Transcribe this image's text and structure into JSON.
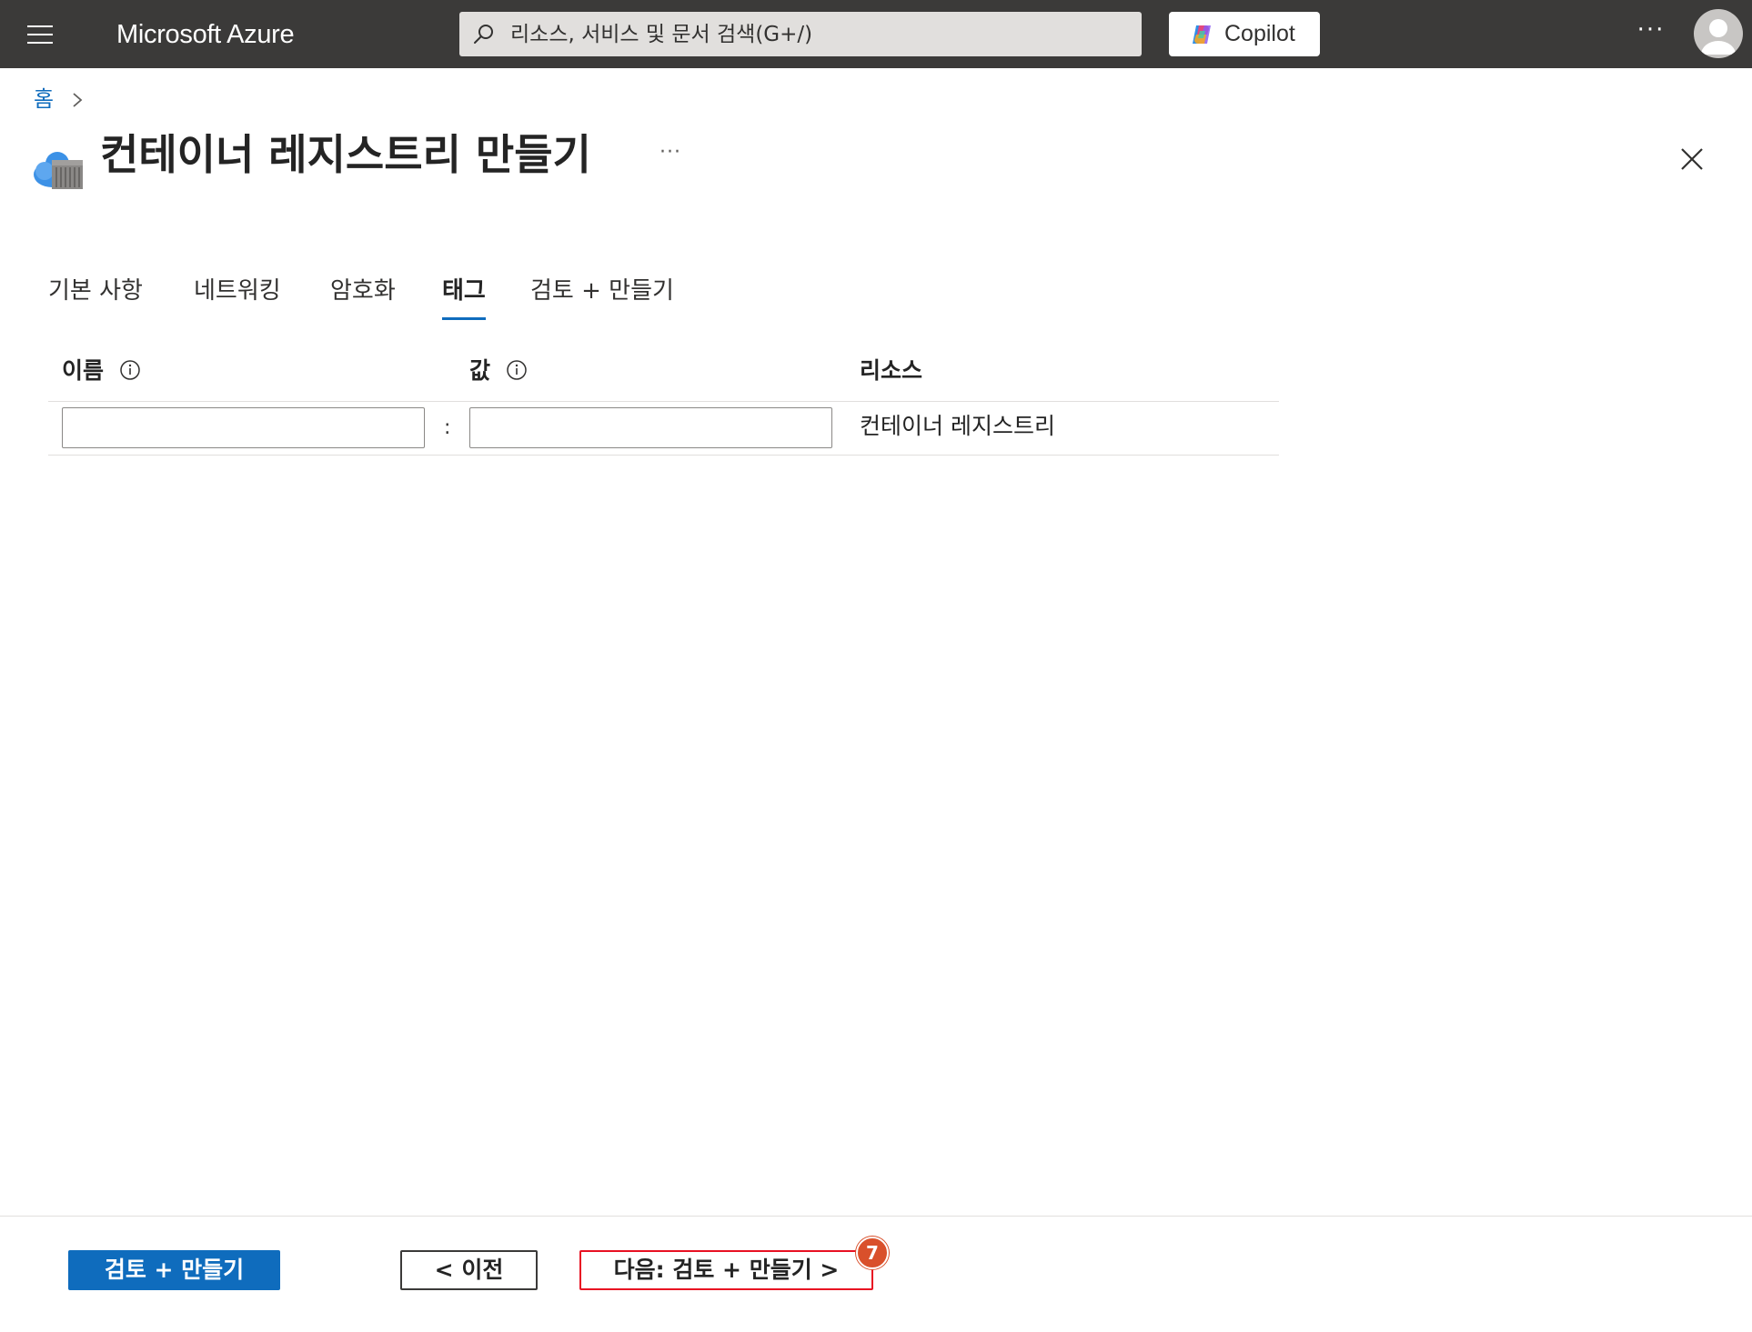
{
  "topbar": {
    "brand": "Microsoft Azure",
    "search_placeholder": "리소스, 서비스 및 문서 검색(G+/)",
    "copilot_label": "Copilot",
    "more_label": "···"
  },
  "breadcrumb": {
    "home": "홈"
  },
  "header": {
    "title": "컨테이너 레지스트리 만들기",
    "more_label": "···"
  },
  "tabs": [
    {
      "label": "기본 사항",
      "active": false
    },
    {
      "label": "네트워킹",
      "active": false
    },
    {
      "label": "암호화",
      "active": false
    },
    {
      "label": "태그",
      "active": true
    },
    {
      "label": "검토 + 만들기",
      "active": false
    }
  ],
  "grid": {
    "columns": {
      "name": "이름",
      "value": "값",
      "resource": "리소스"
    },
    "rows": [
      {
        "name": "",
        "value": "",
        "resource": "컨테이너 레지스트리"
      }
    ],
    "separator": ":"
  },
  "footer": {
    "review_create": "검토 + 만들기",
    "previous": "< 이전",
    "next": "다음: 검토 + 만들기 >",
    "step_badge": "7"
  },
  "colors": {
    "topbar": "#3b3a39",
    "accent": "#0f6cbd",
    "highlight": "#e81123",
    "badge": "#d9502b"
  }
}
